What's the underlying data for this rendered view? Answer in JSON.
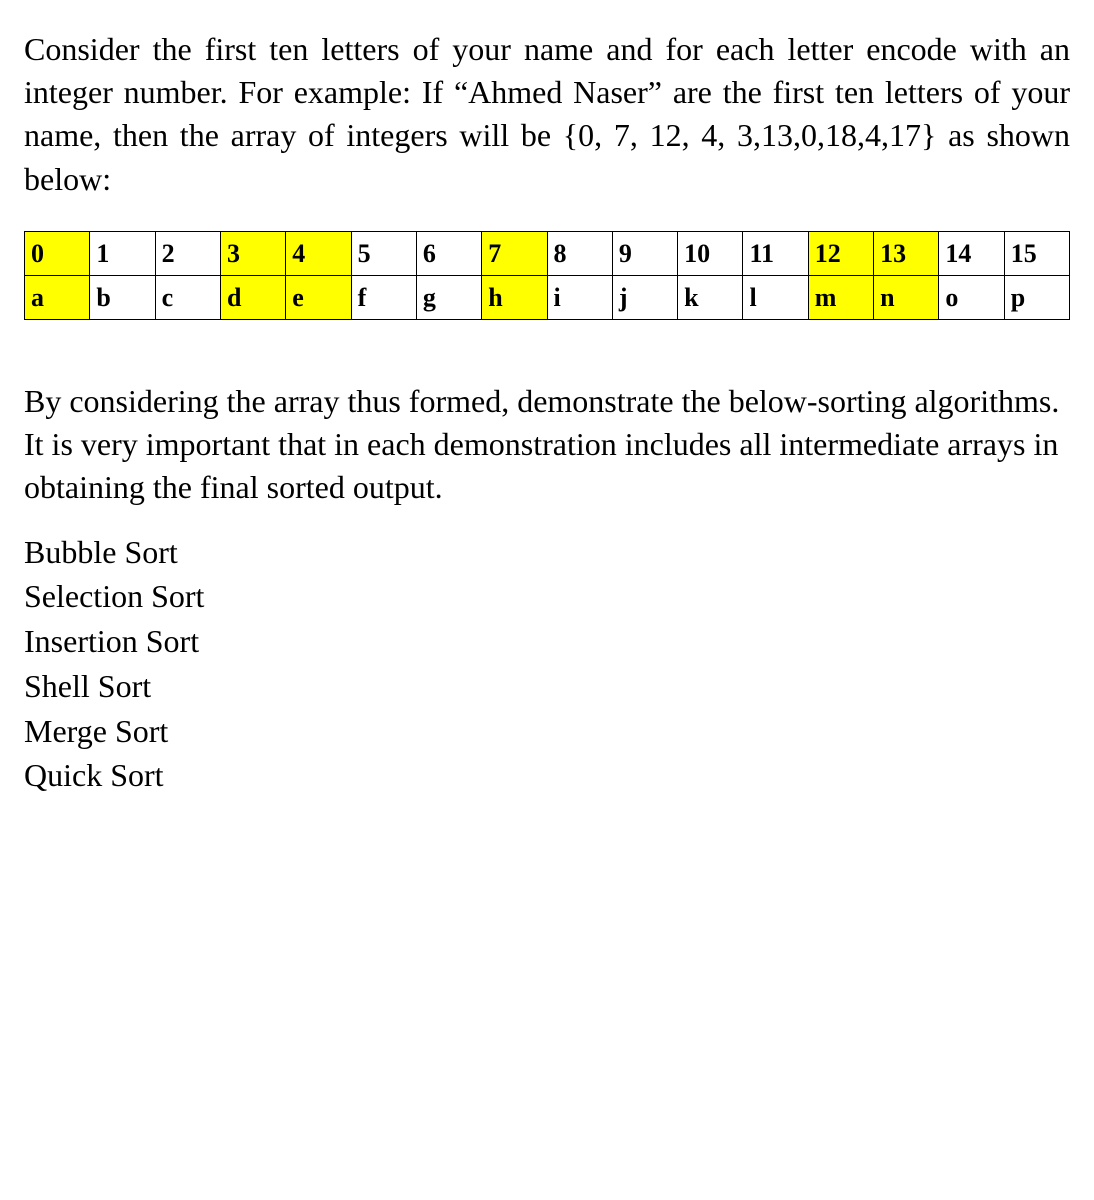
{
  "paragraph1": "Consider the first ten letters of your name and for each letter encode with an integer number. For example: If “Ahmed Naser” are the first ten letters of your name, then the array of integers will be {0, 7, 12, 4, 3,13,0,18,4,17} as shown below:",
  "table": {
    "row1": [
      {
        "val": "0",
        "hl": true
      },
      {
        "val": "1",
        "hl": false
      },
      {
        "val": "2",
        "hl": false
      },
      {
        "val": "3",
        "hl": true
      },
      {
        "val": "4",
        "hl": true
      },
      {
        "val": "5",
        "hl": false
      },
      {
        "val": "6",
        "hl": false
      },
      {
        "val": "7",
        "hl": true
      },
      {
        "val": "8",
        "hl": false
      },
      {
        "val": "9",
        "hl": false
      },
      {
        "val": "10",
        "hl": false
      },
      {
        "val": "11",
        "hl": false
      },
      {
        "val": "12",
        "hl": true
      },
      {
        "val": "13",
        "hl": true
      },
      {
        "val": "14",
        "hl": false
      },
      {
        "val": "15",
        "hl": false
      }
    ],
    "row2": [
      {
        "val": "a",
        "hl": true
      },
      {
        "val": "b",
        "hl": false
      },
      {
        "val": "c",
        "hl": false
      },
      {
        "val": "d",
        "hl": true
      },
      {
        "val": "e",
        "hl": true
      },
      {
        "val": "f",
        "hl": false
      },
      {
        "val": "g",
        "hl": false
      },
      {
        "val": "h",
        "hl": true
      },
      {
        "val": "i",
        "hl": false
      },
      {
        "val": "j",
        "hl": false
      },
      {
        "val": "k",
        "hl": false
      },
      {
        "val": "l",
        "hl": false
      },
      {
        "val": "m",
        "hl": true
      },
      {
        "val": "n",
        "hl": true
      },
      {
        "val": "o",
        "hl": false
      },
      {
        "val": "p",
        "hl": false
      }
    ]
  },
  "paragraph2": "By considering the array thus formed, demonstrate the below-sorting algorithms. It is very important that in each demonstration includes all intermediate arrays in obtaining the final sorted output.",
  "sortList": [
    "Bubble Sort",
    "Selection Sort",
    "Insertion Sort",
    "Shell Sort",
    "Merge Sort",
    "Quick Sort"
  ]
}
